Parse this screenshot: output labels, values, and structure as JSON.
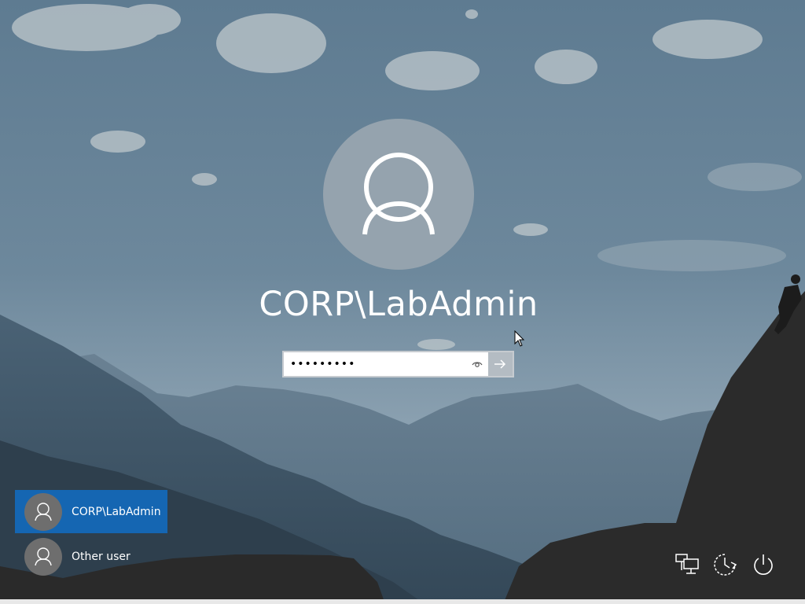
{
  "user": {
    "display_name": "CORP\\LabAdmin"
  },
  "password": {
    "value": "•••••••••",
    "reveal_icon": "eye-icon",
    "submit_icon": "arrow-right-icon"
  },
  "user_list": [
    {
      "label": "CORP\\LabAdmin",
      "selected": true
    },
    {
      "label": "Other user",
      "selected": false
    }
  ],
  "system_buttons": [
    {
      "icon": "network-icon"
    },
    {
      "icon": "ease-of-access-icon"
    },
    {
      "icon": "power-icon"
    }
  ],
  "colors": {
    "selected_tile": "#1566b2",
    "avatar_bg": "#95a3ae",
    "sky": "#5f7a8f"
  }
}
